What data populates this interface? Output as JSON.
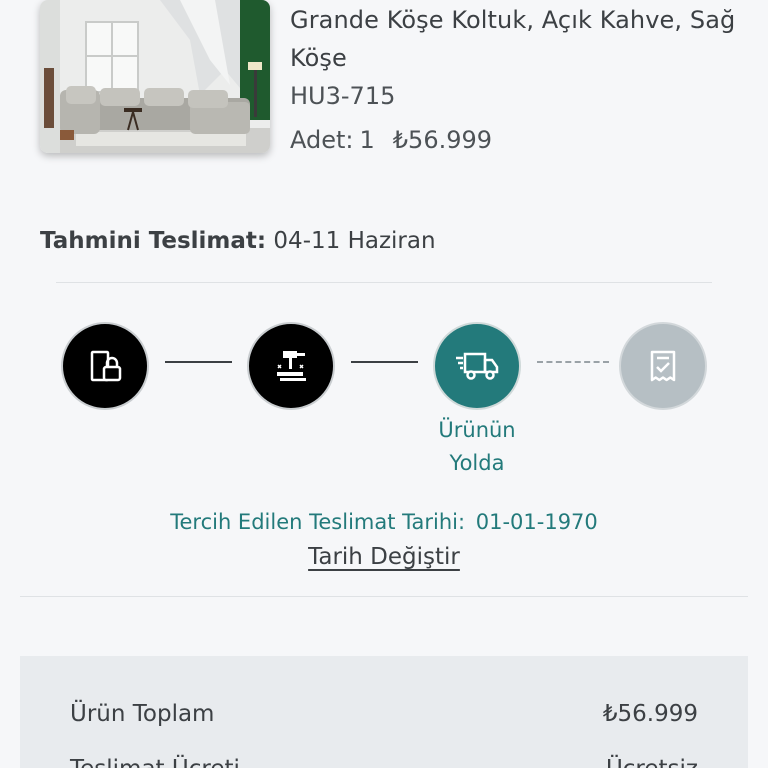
{
  "product": {
    "title": "Grande Köşe Koltuk, Açık Kahve, Sağ Köşe",
    "code": "HU3-715",
    "quantity_label": "Adet:",
    "quantity": "1",
    "price": "₺56.999"
  },
  "delivery": {
    "estimate_label": "Tahmini Teslimat:",
    "estimate_value": "04-11 Haziran"
  },
  "tracking": {
    "steps": [
      {
        "state": "done",
        "icon": "warehouse-lock-icon"
      },
      {
        "state": "done",
        "icon": "production-hammer-icon"
      },
      {
        "state": "active",
        "icon": "delivery-truck-icon",
        "label": "Ürünün Yolda"
      },
      {
        "state": "pending",
        "icon": "delivered-document-icon"
      }
    ],
    "preferred_date_label": "Tercih Edilen Teslimat Tarihi:",
    "preferred_date_value": "01-01-1970",
    "change_date_link": "Tarih Değiştir"
  },
  "summary": {
    "rows": [
      {
        "label": "Ürün Toplam",
        "value": "₺56.999"
      },
      {
        "label": "Teslimat Ücreti",
        "value": "Ücretsiz"
      }
    ]
  },
  "colors": {
    "accent": "#237a7b",
    "done_step": "#000000",
    "pending_step": "#b6bfc4",
    "background": "#f6f7f9",
    "summary_bg": "#e8ebee"
  }
}
